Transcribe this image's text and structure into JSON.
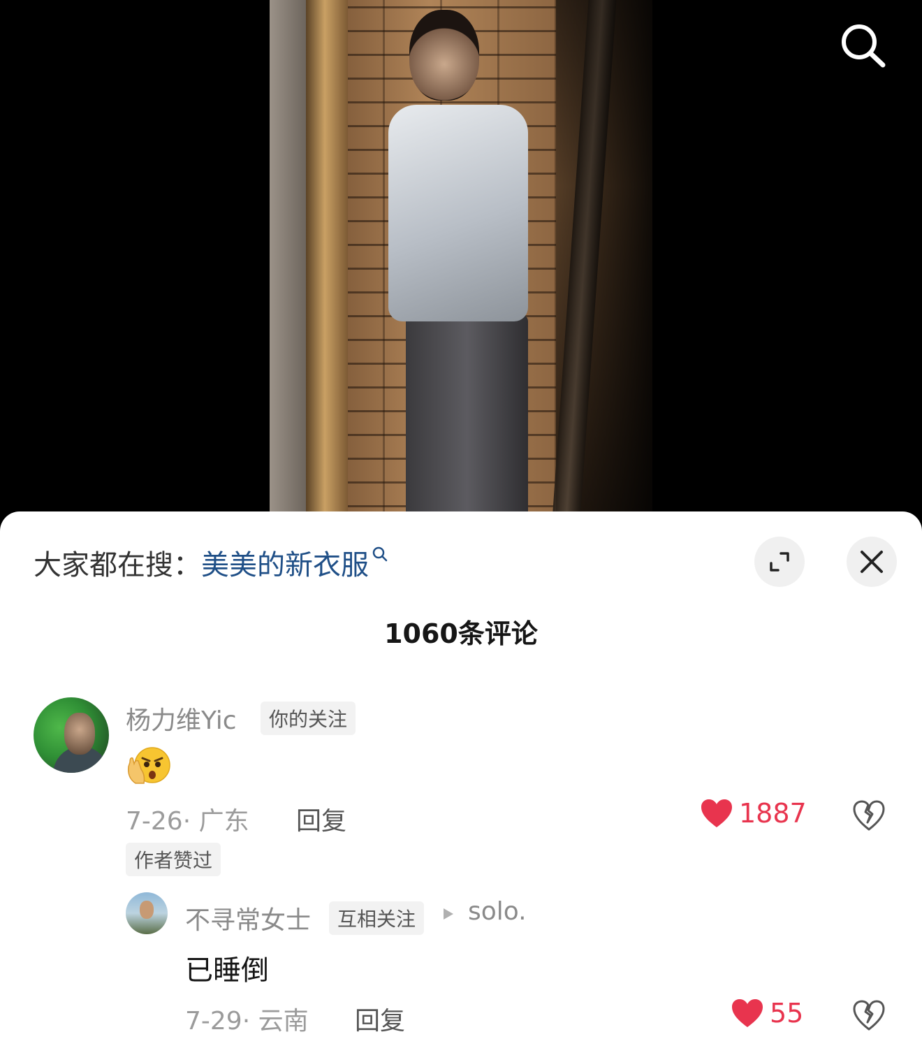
{
  "header": {
    "search_icon": "search-icon"
  },
  "sheet": {
    "trending_prefix": "大家都在搜：",
    "trending_term": "美美的新衣服",
    "expand_icon": "expand-icon",
    "close_icon": "close-icon",
    "comment_count": "1060条评论"
  },
  "comments": [
    {
      "username": "杨力维Yic",
      "badge": "你的关注",
      "content_emoji": "shocked-face-emoji",
      "date_location": "7-26· 广东",
      "reply_label": "回复",
      "likes": "1887",
      "author_liked": "作者赞过"
    },
    {
      "username": "不寻常女士",
      "badge": "互相关注",
      "reply_to": "solo.",
      "text": "已睡倒",
      "date_location": "7-29· 云南",
      "reply_label": "回复",
      "likes": "55"
    }
  ],
  "colors": {
    "like_red": "#e8344e",
    "trending_blue": "#1f4f87"
  }
}
